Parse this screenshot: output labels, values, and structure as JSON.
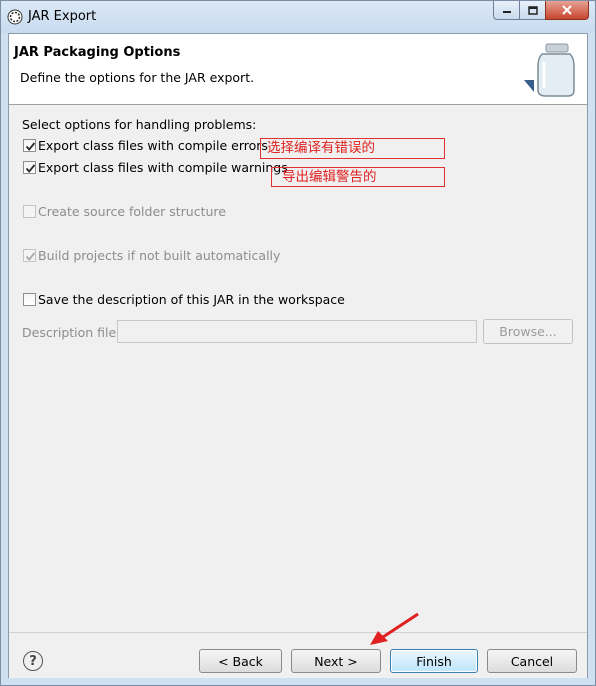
{
  "window": {
    "title": "JAR Export"
  },
  "banner": {
    "title": "JAR Packaging Options",
    "description": "Define the options for the JAR export."
  },
  "options": {
    "section_label": "Select options for handling problems:",
    "export_errors": {
      "label": "Export class files with compile errors",
      "checked": true,
      "enabled": true
    },
    "export_warnings": {
      "label": "Export class files with compile warnings",
      "checked": true,
      "enabled": true
    },
    "create_source_folder": {
      "label": "Create source folder structure",
      "checked": false,
      "enabled": false
    },
    "build_projects": {
      "label": "Build projects if not built automatically",
      "checked": true,
      "enabled": false
    },
    "save_description": {
      "label": "Save the description of this JAR in the workspace",
      "checked": false,
      "enabled": true
    }
  },
  "description_file": {
    "label": "Description file:",
    "value": "",
    "browse_label": "Browse..."
  },
  "annotations": {
    "errors_note": "选择编译有错误的",
    "warnings_note": "导出编辑警告的"
  },
  "buttons": {
    "back": "< Back",
    "next": "Next >",
    "finish": "Finish",
    "cancel": "Cancel"
  },
  "colors": {
    "annotation": "#e02020",
    "default_button": "#3c7fb1"
  }
}
